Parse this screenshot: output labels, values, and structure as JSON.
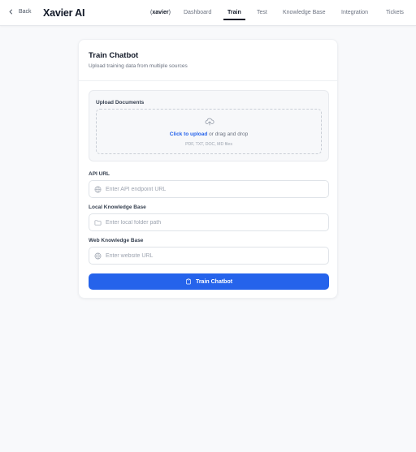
{
  "header": {
    "back_label": "Back",
    "brand": "Xavier AI",
    "context_open": "(",
    "context_name": "xavier",
    "context_close": ")",
    "nav": {
      "dashboard": "Dashboard",
      "train": "Train",
      "test": "Test",
      "knowledge_base": "Knowledge Base",
      "integration": "Integration",
      "tickets": "Tickets"
    },
    "active_tab": "Train"
  },
  "card": {
    "title": "Train Chatbot",
    "subtitle": "Upload training data from multiple sources",
    "upload": {
      "label": "Upload Documents",
      "click_text": "Click to upload",
      "drag_text": " or drag and drop",
      "hint": "PDF, TXT, DOC, MD files"
    },
    "fields": {
      "api_url": {
        "label": "API URL",
        "placeholder": "Enter API endpoint URL",
        "value": ""
      },
      "local_kb": {
        "label": "Local Knowledge Base",
        "placeholder": "Enter local folder path",
        "value": ""
      },
      "web_kb": {
        "label": "Web Knowledge Base",
        "placeholder": "Enter website URL",
        "value": ""
      }
    },
    "button_label": "Train Chatbot"
  },
  "colors": {
    "accent": "#2563eb",
    "background": "#f8f9fb",
    "card": "#ffffff"
  },
  "icons": {
    "back": "chevron-left-icon",
    "upload": "upload-cloud-icon",
    "api": "globe-icon",
    "folder": "folder-icon",
    "web": "globe-icon",
    "button": "clipboard-icon"
  }
}
